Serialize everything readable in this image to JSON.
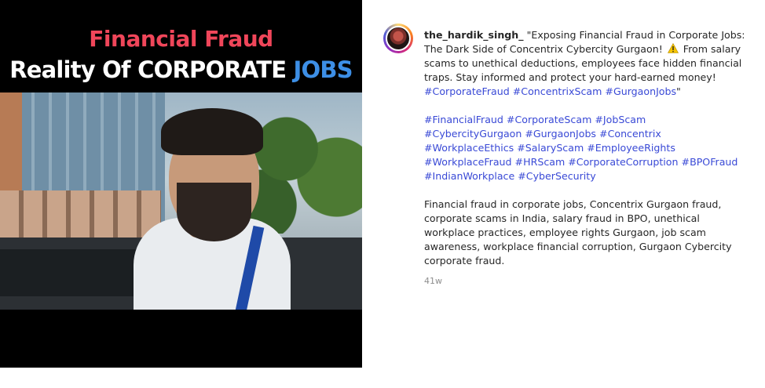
{
  "media": {
    "headline_line1": "Financial Fraud",
    "headline_line2_prefix": "Reality Of CORPORATE ",
    "headline_line2_accent": "JOBS",
    "colors": {
      "line1": "#f0465a",
      "accent": "#3d8fe6"
    }
  },
  "post": {
    "username": "the_hardik_singh_",
    "caption_part1": "\"Exposing Financial Fraud in Corporate Jobs: The Dark Side of Concentrix Cybercity Gurgaon! ",
    "warning_icon": "warning-icon",
    "caption_part2": " From salary scams to unethical deductions, employees face hidden financial traps. Stay informed and protect your hard-earned money!",
    "caption_tags_1": [
      "#CorporateFraud",
      "#ConcentrixScam",
      "#GurgaonJobs"
    ],
    "caption_tags_1_suffix": "\"",
    "hashtags": [
      "#FinancialFraud",
      "#CorporateScam",
      "#JobScam",
      "#CybercityGurgaon",
      "#GurgaonJobs",
      "#Concentrix",
      "#WorkplaceEthics",
      "#SalaryScam",
      "#EmployeeRights",
      "#WorkplaceFraud",
      "#HRScam",
      "#CorporateCorruption",
      "#BPOFraud",
      "#IndianWorkplace",
      "#CyberSecurity"
    ],
    "keywords_paragraph": "Financial fraud in corporate jobs, Concentrix Gurgaon fraud, corporate scams in India, salary fraud in BPO, unethical workplace practices, employee rights Gurgaon, job scam awareness, workplace financial corruption, Gurgaon Cybercity corporate fraud.",
    "timestamp": "41w"
  }
}
